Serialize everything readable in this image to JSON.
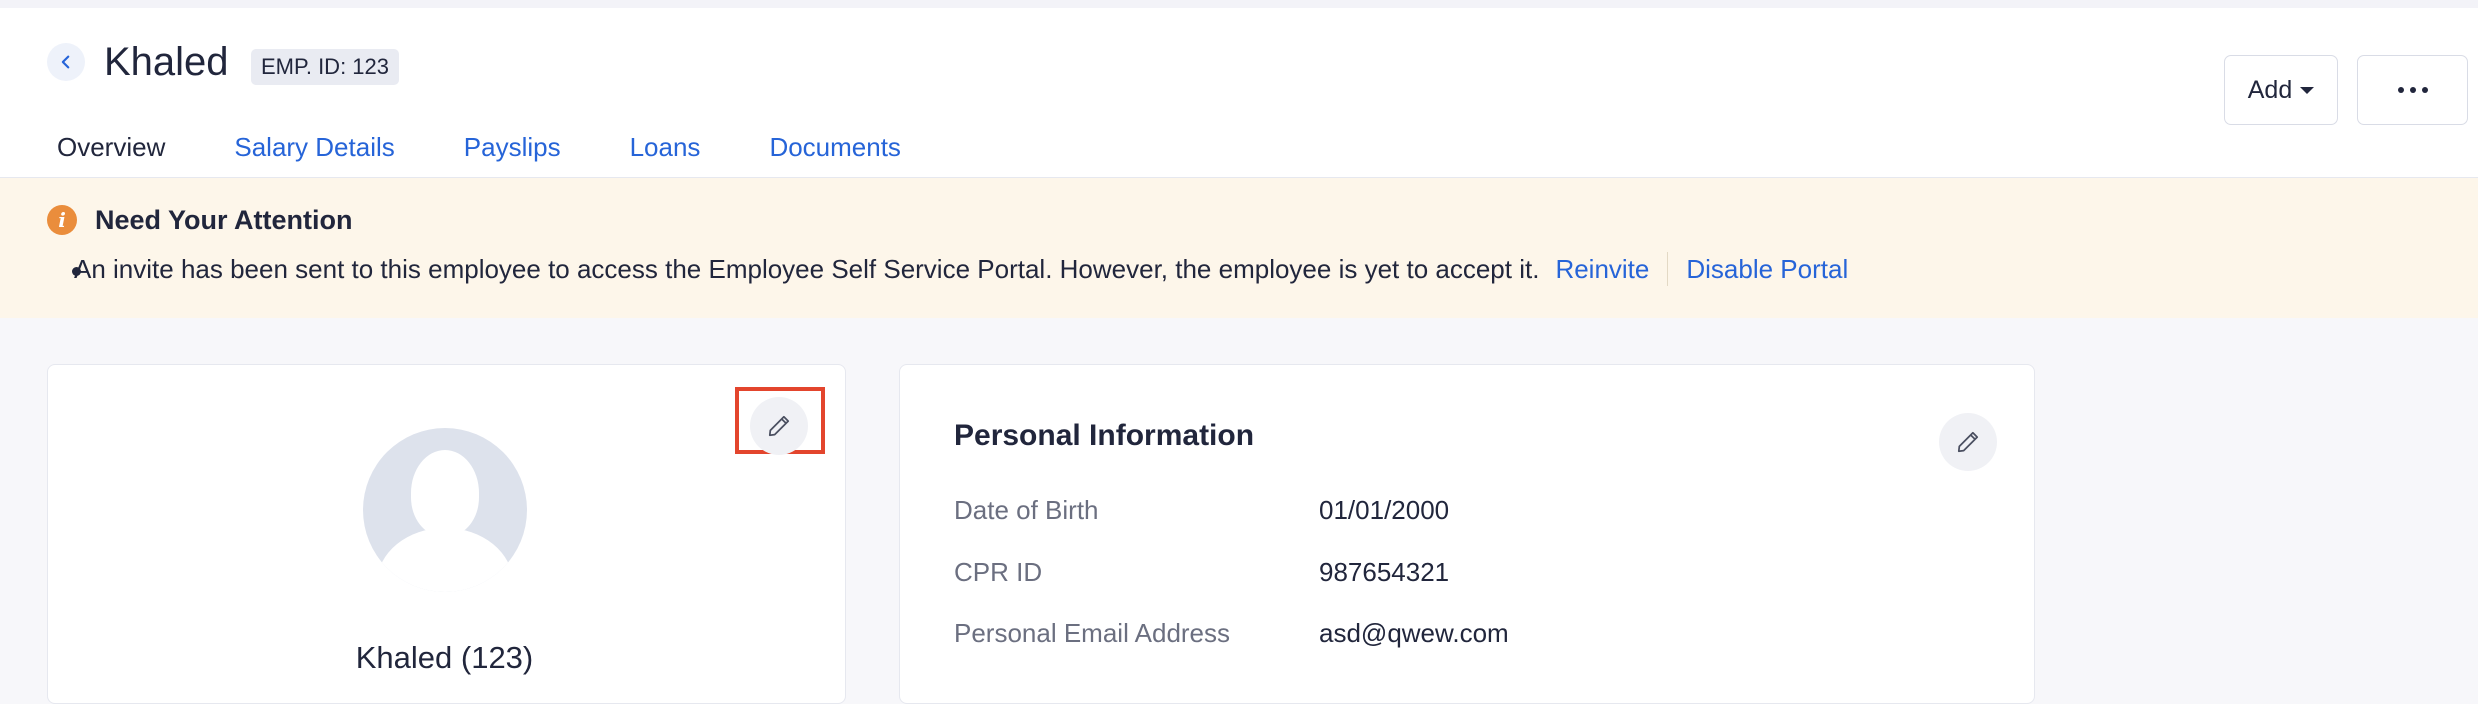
{
  "header": {
    "name": "Khaled",
    "emp_id": "EMP. ID: 123",
    "add_label": "Add"
  },
  "tabs": [
    {
      "label": "Overview",
      "active": true
    },
    {
      "label": "Salary Details",
      "active": false
    },
    {
      "label": "Payslips",
      "active": false
    },
    {
      "label": "Loans",
      "active": false
    },
    {
      "label": "Documents",
      "active": false
    }
  ],
  "alert": {
    "title": "Need Your Attention",
    "message": "An invite has been sent to this employee to access the Employee Self Service Portal. However, the employee is yet to accept it.",
    "reinvite_label": "Reinvite",
    "disable_label": "Disable Portal"
  },
  "profile": {
    "display_name": "Khaled (123)"
  },
  "personal_info": {
    "title": "Personal Information",
    "rows": [
      {
        "label": "Date of Birth",
        "value": "01/01/2000"
      },
      {
        "label": "CPR ID",
        "value": "987654321"
      },
      {
        "label": "Personal Email Address",
        "value": "asd@qwew.com"
      }
    ]
  },
  "colors": {
    "accent": "#2664d8",
    "alert_bg": "#fdf6ea",
    "alert_icon": "#ea8d3c",
    "highlight_border": "#e3452d"
  }
}
